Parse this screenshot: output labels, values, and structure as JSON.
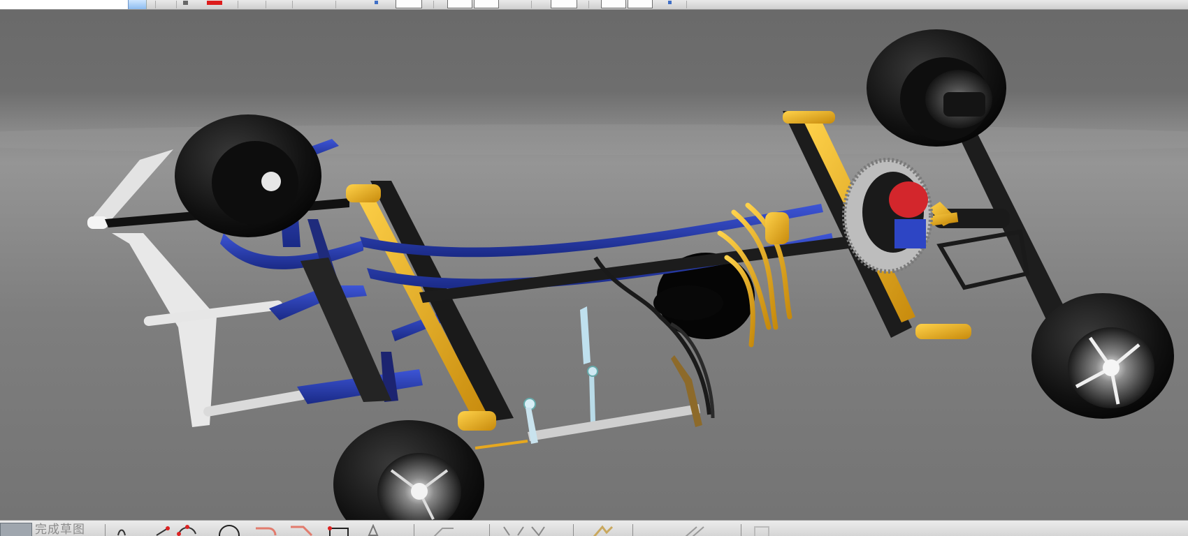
{
  "toolbar_top": {
    "icons": [
      "view-field",
      "dropdown-icon",
      "color-swatch-icon",
      "front-view-icon",
      "top-view-icon",
      "side-view-icon",
      "camera-icon",
      "split-view-icon",
      "iso-view-icon"
    ]
  },
  "viewport": {
    "content": "3d-chassis-model",
    "colors": {
      "background": "#6e6e6e",
      "frame": "#1c1c1c",
      "leaf_spring": "#2438a8",
      "control_arm": "#f2b01e",
      "tire": "#111111",
      "front_frame": "#e8e8e8"
    }
  },
  "toolbar_bottom": {
    "mode_label": "完成草图",
    "icons": [
      "finish-sketch-icon",
      "sketch-tool-icon",
      "line-icon",
      "arc-icon",
      "circle-icon",
      "fillet-icon",
      "trim-icon",
      "rectangle-icon",
      "dimension-icon",
      "constraint-icon",
      "pattern-icon",
      "mirror-icon",
      "offset-icon",
      "project-icon"
    ]
  }
}
